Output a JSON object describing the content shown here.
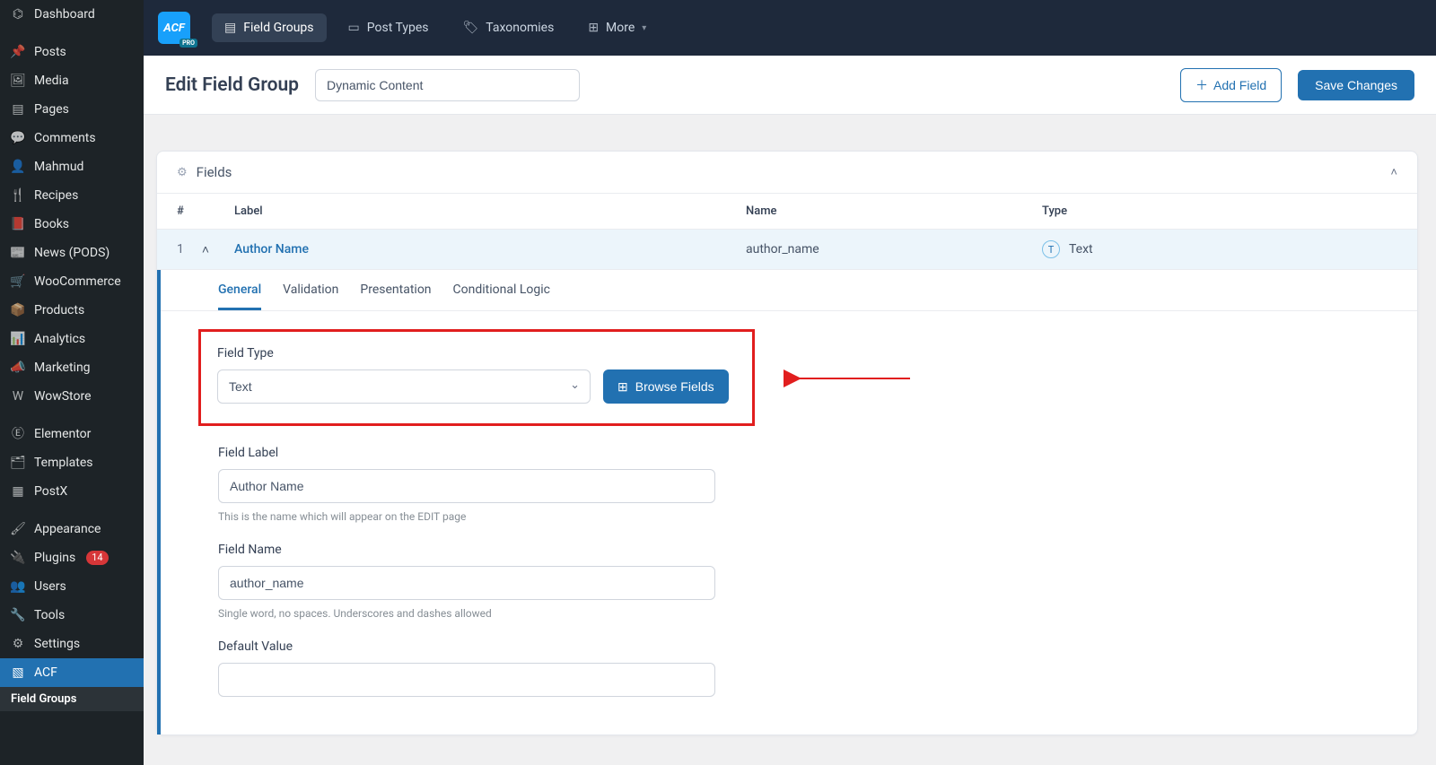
{
  "sidebar": {
    "items": [
      {
        "icon": "⌬",
        "label": "Dashboard"
      },
      {
        "icon": "📌",
        "label": "Posts"
      },
      {
        "icon": "🖼",
        "label": "Media"
      },
      {
        "icon": "▤",
        "label": "Pages"
      },
      {
        "icon": "💬",
        "label": "Comments"
      },
      {
        "icon": "👤",
        "label": "Mahmud"
      },
      {
        "icon": "🍴",
        "label": "Recipes"
      },
      {
        "icon": "📕",
        "label": "Books"
      },
      {
        "icon": "📰",
        "label": "News (PODS)"
      },
      {
        "icon": "🛒",
        "label": "WooCommerce"
      },
      {
        "icon": "📦",
        "label": "Products"
      },
      {
        "icon": "📊",
        "label": "Analytics"
      },
      {
        "icon": "📣",
        "label": "Marketing"
      },
      {
        "icon": "W",
        "label": "WowStore"
      },
      {
        "icon": "Ⓔ",
        "label": "Elementor"
      },
      {
        "icon": "🗂",
        "label": "Templates"
      },
      {
        "icon": "▦",
        "label": "PostX"
      },
      {
        "icon": "🖌",
        "label": "Appearance"
      },
      {
        "icon": "🔌",
        "label": "Plugins",
        "badge": "14"
      },
      {
        "icon": "👥",
        "label": "Users"
      },
      {
        "icon": "🔧",
        "label": "Tools"
      },
      {
        "icon": "⚙",
        "label": "Settings"
      },
      {
        "icon": "▧",
        "label": "ACF",
        "selected": true
      }
    ],
    "subitem": "Field Groups"
  },
  "topbar": {
    "logo": "ACF",
    "tabs": [
      {
        "icon": "▤",
        "label": "Field Groups",
        "active": true
      },
      {
        "icon": "▭",
        "label": "Post Types"
      },
      {
        "icon": "🏷",
        "label": "Taxonomies"
      },
      {
        "icon": "⊞",
        "label": "More"
      }
    ]
  },
  "header": {
    "title": "Edit Field Group",
    "group_name": "Dynamic Content",
    "add_field": "Add Field",
    "save": "Save Changes"
  },
  "panel": {
    "title": "Fields",
    "columns": {
      "num": "#",
      "label": "Label",
      "name": "Name",
      "type": "Type"
    },
    "row": {
      "index": "1",
      "label": "Author Name",
      "name": "author_name",
      "type_letter": "T",
      "type": "Text"
    }
  },
  "editor": {
    "tabs": [
      "General",
      "Validation",
      "Presentation",
      "Conditional Logic"
    ],
    "field_type": {
      "label": "Field Type",
      "selected": "Text",
      "browse": "Browse Fields"
    },
    "field_label": {
      "label": "Field Label",
      "value": "Author Name",
      "help": "This is the name which will appear on the EDIT page"
    },
    "field_name": {
      "label": "Field Name",
      "value": "author_name",
      "help": "Single word, no spaces. Underscores and dashes allowed"
    },
    "default_value": {
      "label": "Default Value",
      "value": ""
    }
  }
}
